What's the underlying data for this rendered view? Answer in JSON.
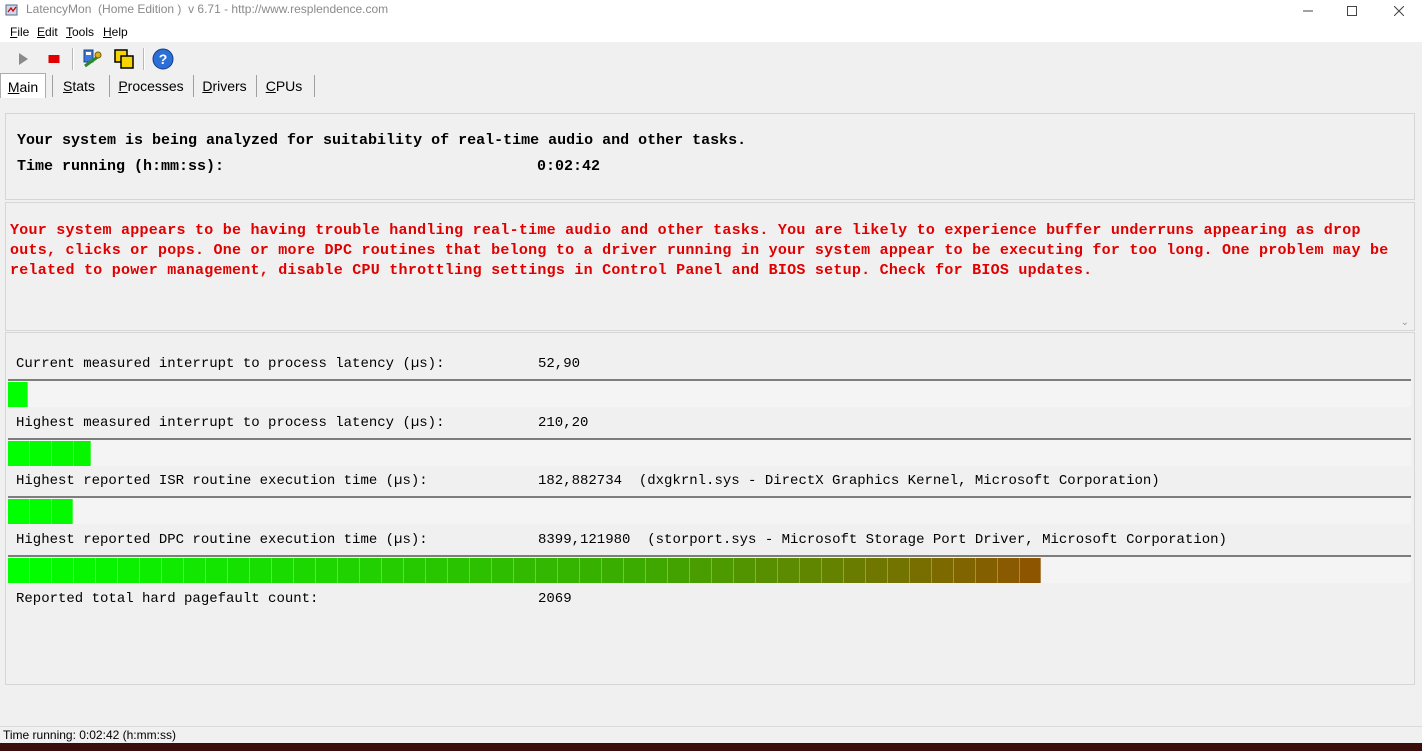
{
  "window": {
    "title": "LatencyMon  (Home Edition )  v 6.71 - http://www.resplendence.com",
    "app_icon": "latencymon-app-icon",
    "controls": [
      "minimize-icon",
      "maximize-icon",
      "close-icon"
    ]
  },
  "menu": {
    "items": [
      {
        "accel": "F",
        "rest": "ile"
      },
      {
        "accel": "E",
        "rest": "dit"
      },
      {
        "accel": "T",
        "rest": "ools"
      },
      {
        "accel": "H",
        "rest": "elp"
      }
    ]
  },
  "toolbar": {
    "icons": [
      "play-icon",
      "stop-icon",
      "analyze-icon",
      "windows-icon",
      "help-icon"
    ],
    "colors": {
      "play": "#8a8a8a",
      "stop": "#e00000",
      "help": "#2c6fd6"
    }
  },
  "tabs": [
    {
      "accel": "M",
      "rest": "ain",
      "active": true
    },
    {
      "accel": "S",
      "rest": "tats"
    },
    {
      "accel": "P",
      "rest": "rocesses"
    },
    {
      "accel": "D",
      "rest": "rivers"
    },
    {
      "accel": "C",
      "rest": "PUs"
    }
  ],
  "status": {
    "line1": "Your system is being analyzed for suitability of real-time audio and other tasks.",
    "time_label": "Time running (h:mm:ss):",
    "time_value": "0:02:42"
  },
  "warning": {
    "text": "Your system appears to be having trouble handling real-time audio and other tasks. You are likely to experience buffer underruns appearing as drop outs, clicks or pops. One or more DPC routines that belong to a driver running in your system appear to be executing for too long. One problem may be related to power management, disable CPU throttling settings in Control Panel and BIOS setup. Check for BIOS updates.",
    "color": "#e00000"
  },
  "measurements": [
    {
      "label": "Current measured interrupt to process latency (µs):",
      "value": "52,90",
      "detail": "",
      "bar_fraction": 0.014
    },
    {
      "label": "Highest measured interrupt to process latency (µs):",
      "value": "210,20",
      "detail": "",
      "bar_fraction": 0.059
    },
    {
      "label": "Highest reported ISR routine execution time (µs):",
      "value": "182,882734",
      "detail": "(dxgkrnl.sys - DirectX Graphics Kernel, Microsoft Corporation)",
      "bar_fraction": 0.046
    },
    {
      "label": "Highest reported DPC routine execution time (µs):",
      "value": "8399,121980",
      "detail": "(storport.sys - Microsoft Storage Port Driver, Microsoft Corporation)",
      "bar_fraction": 0.736
    }
  ],
  "pagefault": {
    "label": "Reported total hard pagefault count:",
    "value": "2069"
  },
  "statusbar": {
    "text": "Time running: 0:02:42  (h:mm:ss)"
  }
}
